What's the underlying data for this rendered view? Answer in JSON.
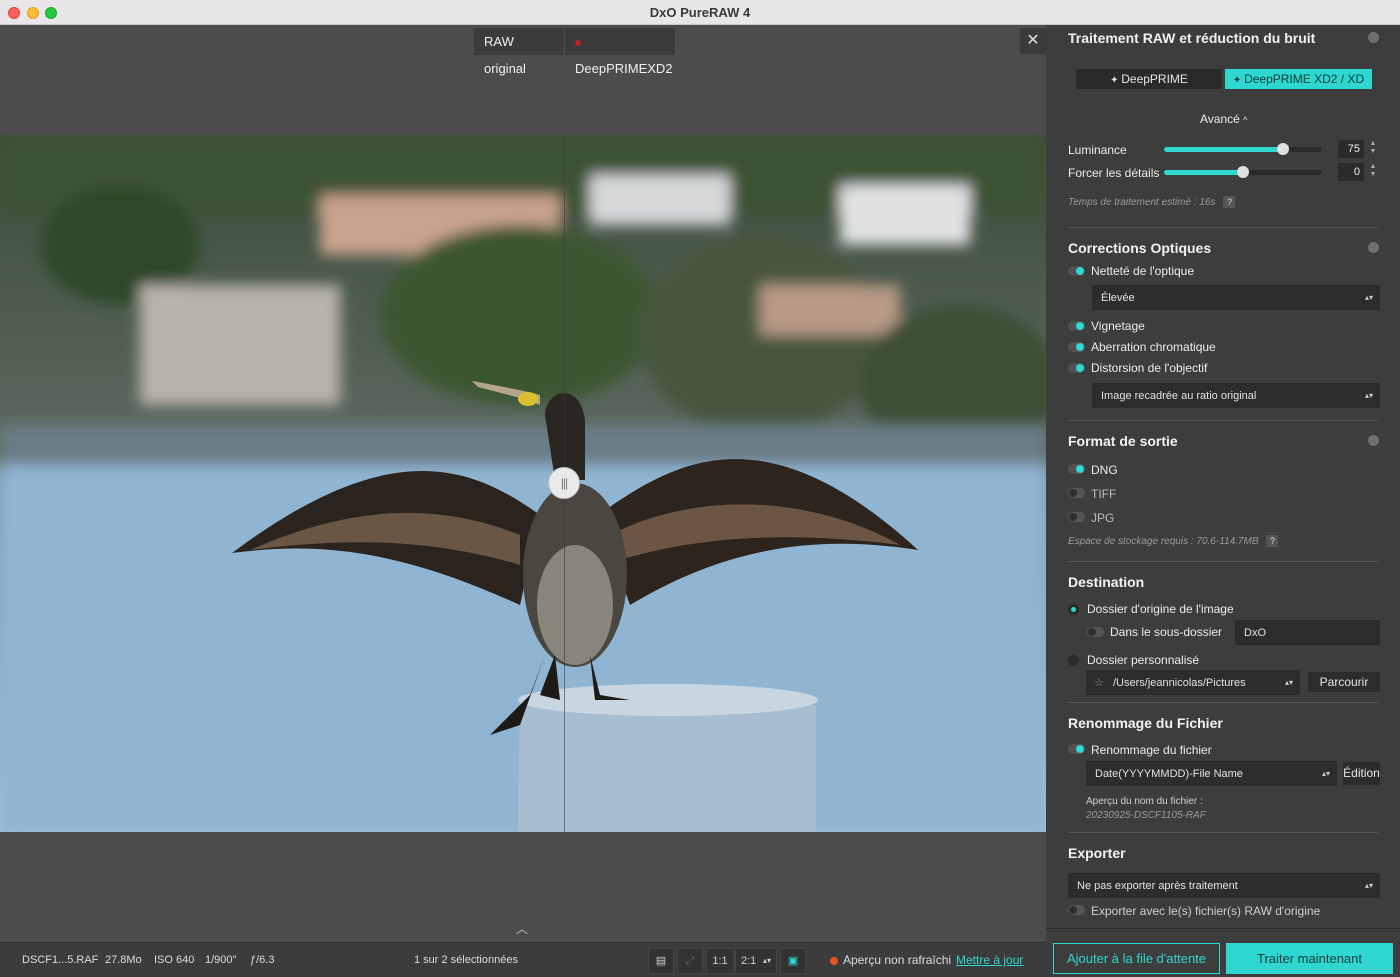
{
  "window": {
    "title": "DxO PureRAW 4"
  },
  "compare": {
    "left_label": "RAW original",
    "right_label": "DeepPRIMEXD2",
    "close": "✕"
  },
  "status": {
    "filename": "DSCF1...5.RAF",
    "size": "27.8Mo",
    "iso": "ISO 640",
    "shutter": "1/900\"",
    "aperture": "ƒ/6.3",
    "selection": "1 sur 2 sélectionnées",
    "zoom_1": "1:1",
    "zoom_2": "2:1",
    "preview_warning": "Aperçu non rafraîchi",
    "update_link": "Mettre à jour"
  },
  "raw": {
    "title": "Traitement RAW et réduction du bruit",
    "method_1": "DeepPRIME",
    "method_2": "DeepPRIME XD2 / XD",
    "advanced": "Avancé",
    "luminance_label": "Luminance",
    "luminance_value": "75",
    "luminance_fraction": 0.75,
    "details_label": "Forcer les détails",
    "details_value": "0",
    "details_fraction": 0.5,
    "time_note": "Temps de traitement estimé : 16s"
  },
  "optics": {
    "title": "Corrections Optiques",
    "sharpness": "Netteté de l'optique",
    "sharpness_level": "Élevée",
    "vignetting": "Vignetage",
    "chromatic": "Aberration chromatique",
    "distortion": "Distorsion de l'objectif",
    "distortion_mode": "Image recadrée au ratio original"
  },
  "output": {
    "title": "Format de sortie",
    "dng": "DNG",
    "tiff": "TIFF",
    "jpg": "JPG",
    "storage_note": "Espace de stockage requis : 70.6-114.7MB"
  },
  "destination": {
    "title": "Destination",
    "origin_folder": "Dossier d'origine de l'image",
    "subfolder_label": "Dans le sous-dossier",
    "subfolder_value": "DxO",
    "custom_folder": "Dossier personnalisé",
    "path": "/Users/jeannicolas/Pictures",
    "browse": "Parcourir"
  },
  "rename": {
    "title": "Renommage du Fichier",
    "toggle_label": "Renommage du fichier",
    "pattern": "Date(YYYYMMDD)-File Name",
    "edit": "Édition",
    "preview_label": "Aperçu du nom du fichier :",
    "preview_value": "20230925-DSCF1105-RAF"
  },
  "export": {
    "title": "Exporter",
    "mode": "Ne pas exporter après traitement",
    "with_raw": "Exporter avec le(s) fichier(s) RAW d'origine"
  },
  "actions": {
    "queue": "Ajouter à la file d'attente",
    "process": "Traiter maintenant"
  },
  "colors": {
    "accent": "#2ed8d0",
    "warning": "#e8541e"
  }
}
